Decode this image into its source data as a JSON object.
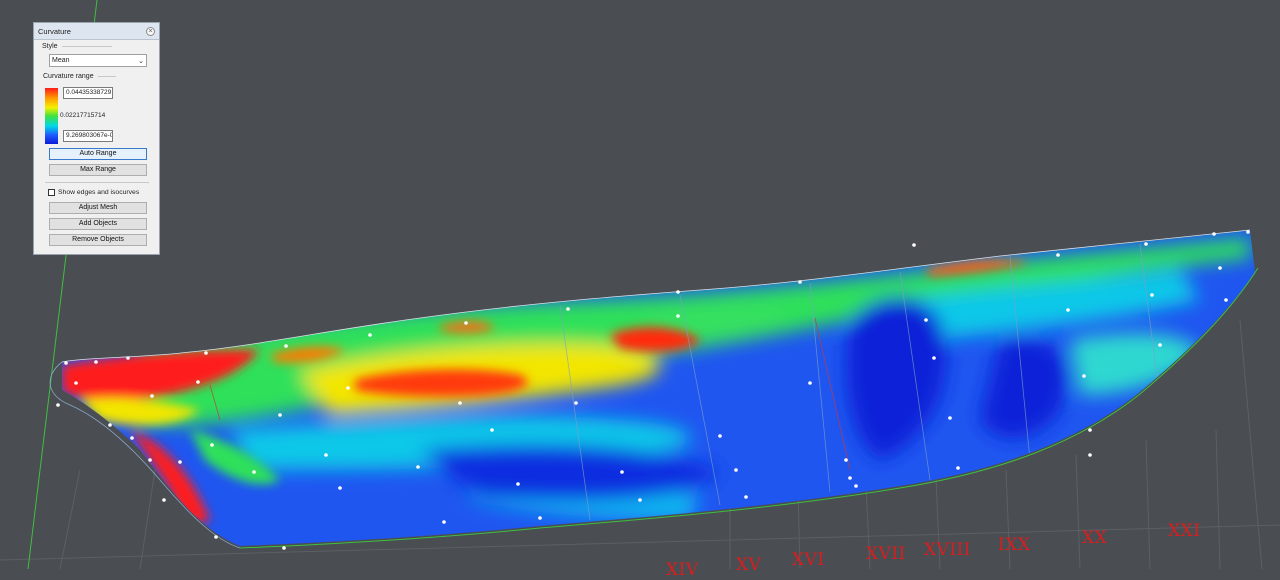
{
  "panel": {
    "title": "Curvature",
    "close_glyph": "×",
    "style_label": "Style",
    "style_value": "Mean",
    "curvature_range_label": "Curvature range",
    "max_value": "0.04435338729",
    "mid_value": "0.02217715714",
    "min_value": "9.269803067e-0",
    "auto_range_label": "Auto Range",
    "max_range_label": "Max Range",
    "show_edges_label": "Show edges and isocurves",
    "show_edges_checked": false,
    "adjust_mesh_label": "Adjust Mesh",
    "add_objects_label": "Add Objects",
    "remove_objects_label": "Remove Objects"
  },
  "stations": [
    {
      "label": "XIV"
    },
    {
      "label": "XV"
    },
    {
      "label": "XVI"
    },
    {
      "label": "XVII"
    },
    {
      "label": "XVIII"
    },
    {
      "label": "IXX"
    },
    {
      "label": "XX"
    },
    {
      "label": "XXI"
    }
  ],
  "colors": {
    "background": "#4a4d52",
    "station_label": "#d81e1e",
    "curvature_high": "#ff1a1a",
    "curvature_mid": "#3fe23f",
    "curvature_low": "#0b1ad8"
  }
}
